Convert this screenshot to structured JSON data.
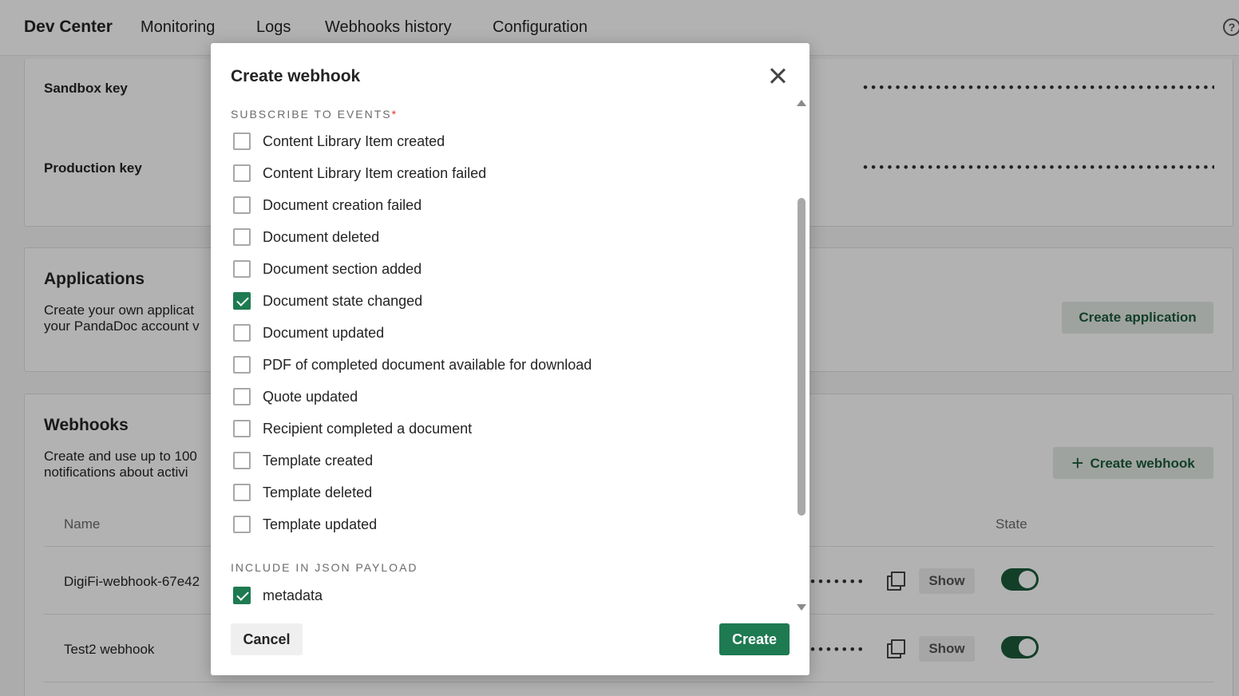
{
  "nav": {
    "brand": "Dev Center",
    "items": [
      "Monitoring",
      "Logs",
      "Webhooks history",
      "Configuration"
    ],
    "help_icon": "help-circle-icon"
  },
  "keys": {
    "sandbox_label": "Sandbox key",
    "production_label": "Production key",
    "masked": "••••••••••••••••••••••••••••••••••••••••••••••••"
  },
  "applications": {
    "title": "Applications",
    "desc_line1": "Create your own applicat",
    "desc_line2": "your PandaDoc account v",
    "button": "Create application"
  },
  "webhooks": {
    "title": "Webhooks",
    "desc_line1": "Create and use up to 100",
    "desc_line2": "notifications about activi",
    "button": "Create webhook",
    "col_name": "Name",
    "col_state": "State",
    "rows": [
      {
        "name": "DigiFi-webhook-67e42",
        "masked": "•••••••",
        "show": "Show",
        "enabled": true
      },
      {
        "name": "Test2 webhook",
        "masked": "•••••••",
        "show": "Show",
        "enabled": true
      }
    ]
  },
  "modal": {
    "title": "Create webhook",
    "events_label": "SUBSCRIBE TO EVENTS",
    "required_mark": "*",
    "events": [
      {
        "label": "Content Library Item created",
        "checked": false
      },
      {
        "label": "Content Library Item creation failed",
        "checked": false
      },
      {
        "label": "Document creation failed",
        "checked": false
      },
      {
        "label": "Document deleted",
        "checked": false
      },
      {
        "label": "Document section added",
        "checked": false
      },
      {
        "label": "Document state changed",
        "checked": true
      },
      {
        "label": "Document updated",
        "checked": false
      },
      {
        "label": "PDF of completed document available for download",
        "checked": false
      },
      {
        "label": "Quote updated",
        "checked": false
      },
      {
        "label": "Recipient completed a document",
        "checked": false
      },
      {
        "label": "Template created",
        "checked": false
      },
      {
        "label": "Template deleted",
        "checked": false
      },
      {
        "label": "Template updated",
        "checked": false
      }
    ],
    "payload_label": "INCLUDE IN JSON PAYLOAD",
    "payload": [
      {
        "label": "metadata",
        "checked": true
      }
    ],
    "cancel": "Cancel",
    "create": "Create"
  },
  "colors": {
    "primary": "#1e7a51",
    "primary_dark": "#1c5b3c",
    "required": "#e0352c"
  }
}
